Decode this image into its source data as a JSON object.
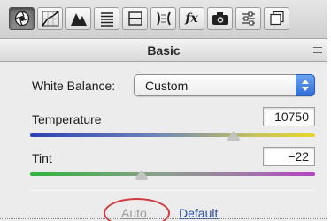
{
  "toolbar": {
    "tabs": [
      {
        "icon": "aperture-icon",
        "active": true
      },
      {
        "icon": "tone-curve-icon"
      },
      {
        "icon": "detail-icon"
      },
      {
        "icon": "hsl-grayscale-icon"
      },
      {
        "icon": "split-toning-icon"
      },
      {
        "icon": "lens-corrections-icon"
      },
      {
        "icon": "effects-fx-icon",
        "label": "fx"
      },
      {
        "icon": "camera-calibration-icon"
      },
      {
        "icon": "presets-icon"
      },
      {
        "icon": "snapshots-icon"
      }
    ]
  },
  "section": {
    "title": "Basic"
  },
  "white_balance": {
    "label": "White Balance:",
    "value": "Custom"
  },
  "temperature": {
    "label": "Temperature",
    "value": "10750"
  },
  "tint": {
    "label": "Tint",
    "value": "−22"
  },
  "links": {
    "auto": "Auto",
    "default": "Default"
  },
  "colors": {
    "highlight": "#d0393f",
    "link": "#2a4fa8",
    "disabled_link": "#9a9a9a"
  }
}
